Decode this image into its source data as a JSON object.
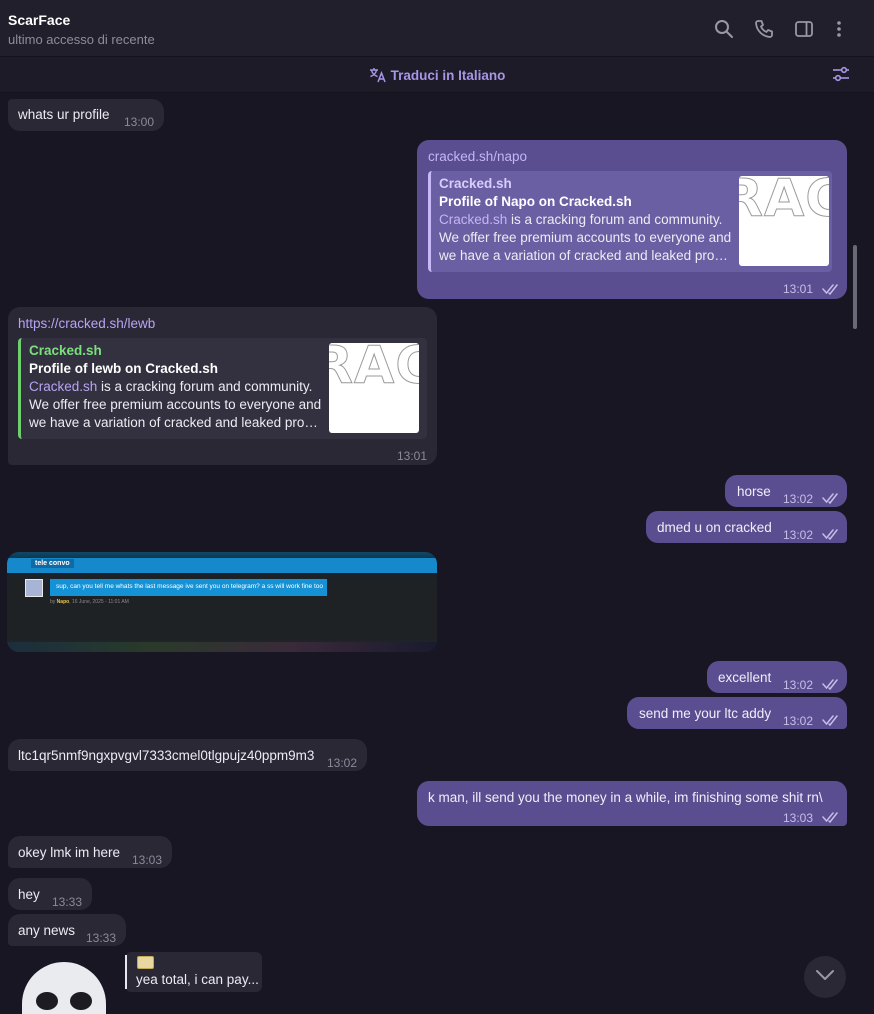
{
  "header": {
    "contact_name": "ScarFace",
    "status": "ultimo accesso di recente",
    "icons": [
      "search-icon",
      "phone-icon",
      "sidebar-icon",
      "more-icon"
    ]
  },
  "translate_bar": {
    "label": "Traduci in Italiano",
    "icon": "translate-icon",
    "filter_icon": "filter-icon"
  },
  "messages": {
    "m1": {
      "text": "whats ur profile",
      "time": "13:00"
    },
    "m2": {
      "link": "cracked.sh/napo",
      "preview_site": "Cracked.sh",
      "preview_title": "Profile of Napo on Cracked.sh",
      "desc_link": "Cracked.sh",
      "desc_rest": " is a cracking forum and community.",
      "desc_line2": "We offer free premium accounts to everyone and",
      "desc_line3": "we have a variation of cracked and leaked programs",
      "thumb_text": "RACI",
      "time": "13:01"
    },
    "m3": {
      "link": "https://cracked.sh/lewb",
      "preview_site": "Cracked.sh",
      "preview_title": "Profile of lewb on Cracked.sh",
      "desc_link": "Cracked.sh",
      "desc_rest": " is a cracking forum and community.",
      "desc_line2": "We offer free premium accounts to everyone and",
      "desc_line3": "we have a variation of cracked and leaked programs",
      "thumb_text": "RACI",
      "time": "13:01"
    },
    "m4": {
      "text": "horse",
      "time": "13:02"
    },
    "m5": {
      "text": "dmed u on cracked",
      "time": "13:02"
    },
    "m6": {
      "image_tab": "tele convo",
      "image_msg": "sup, can you tell me whats the last message ive sent you on telegram? a ss will work fine too",
      "image_meta_by": "by",
      "image_meta_user": "Napo",
      "image_meta_date": ", 16 June, 2025 - 11:01 AM"
    },
    "m7": {
      "text": "excellent",
      "time": "13:02"
    },
    "m8": {
      "text": "send me your ltc addy",
      "time": "13:02"
    },
    "m9": {
      "text": "ltc1qr5nmf9ngxpvgvl7333cmel0tlgpujz40ppm9m3",
      "time": "13:02"
    },
    "m10": {
      "text": "k man, ill send you the money in a while, im finishing some shit rn\\",
      "time": "13:03"
    },
    "m11": {
      "text": "okey lmk im here",
      "time": "13:03"
    },
    "m12": {
      "text": "hey",
      "time": "13:33"
    },
    "m13": {
      "text": "any news",
      "time": "13:33"
    },
    "m14": {
      "reply_text": "yea total, i can pay..."
    }
  },
  "colors": {
    "background": "#181622",
    "incoming_bubble": "#2a2835",
    "outgoing_bubble": "#5a4e91",
    "accent": "#a895e6"
  }
}
